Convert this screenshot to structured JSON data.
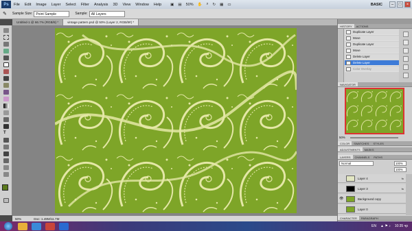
{
  "app": {
    "logo": "Ps",
    "menu": [
      "File",
      "Edit",
      "Image",
      "Layer",
      "Select",
      "Filter",
      "Analysis",
      "3D",
      "View",
      "Window",
      "Help"
    ],
    "zoom_menu": "50%",
    "workspace": "BASIC",
    "window_controls": [
      "–",
      "□",
      "×"
    ]
  },
  "options": {
    "sample_size_label": "Sample Size:",
    "sample_size_value": "Point Sample",
    "sample_label": "Sample:",
    "sample_value": "All Layers"
  },
  "tabs": [
    {
      "label": "Untitled-1 @ 66.7% (RGB/8) *"
    },
    {
      "label": "vintage pattern.psd @ 50% (Layer 2, RGB/8#) *"
    }
  ],
  "status": {
    "zoom": "50%",
    "doc": "Doc: 1.49M/11.7M"
  },
  "history": {
    "tabs": [
      "HISTORY",
      "ACTIONS"
    ],
    "items": [
      {
        "label": "Duplicate Layer",
        "state": "normal"
      },
      {
        "label": "Move",
        "state": "normal"
      },
      {
        "label": "Duplicate Layer",
        "state": "normal"
      },
      {
        "label": "Move",
        "state": "normal"
      },
      {
        "label": "Delete Layer",
        "state": "normal"
      },
      {
        "label": "Delete Layer",
        "state": "selected"
      },
      {
        "label": "Color Overlay",
        "state": "dim"
      }
    ]
  },
  "navigator": {
    "tabs": [
      "NAVIGATOR"
    ],
    "zoom": "50%"
  },
  "color_panel": {
    "tabs": [
      "COLOR",
      "SWATCHES",
      "STYLES"
    ]
  },
  "adjust_panel": {
    "tabs": [
      "ADJUSTMENTS",
      "MASKS"
    ]
  },
  "layers": {
    "tabs": [
      "LAYERS",
      "CHANNELS",
      "PATHS"
    ],
    "blend_mode": "Normal",
    "opacity": "100%",
    "fill": "100%",
    "items": [
      {
        "name": "Layer 4",
        "thumb": "light",
        "visible": false
      },
      {
        "name": "Layer 3",
        "thumb": "black",
        "visible": false
      },
      {
        "name": "Background copy",
        "thumb": "green",
        "visible": true
      },
      {
        "name": "Layer 0",
        "thumb": "green",
        "visible": false
      }
    ]
  },
  "bottom_panel": {
    "tabs": [
      "CHARACTER",
      "PARAGRAPH"
    ]
  },
  "taskbar": {
    "lang": "EN",
    "clock": "10:35 чр"
  },
  "colors": {
    "canvas_green": "#7ea528",
    "pattern_cream": "#e4e7a6",
    "selection_blue": "#3d7bd8"
  }
}
